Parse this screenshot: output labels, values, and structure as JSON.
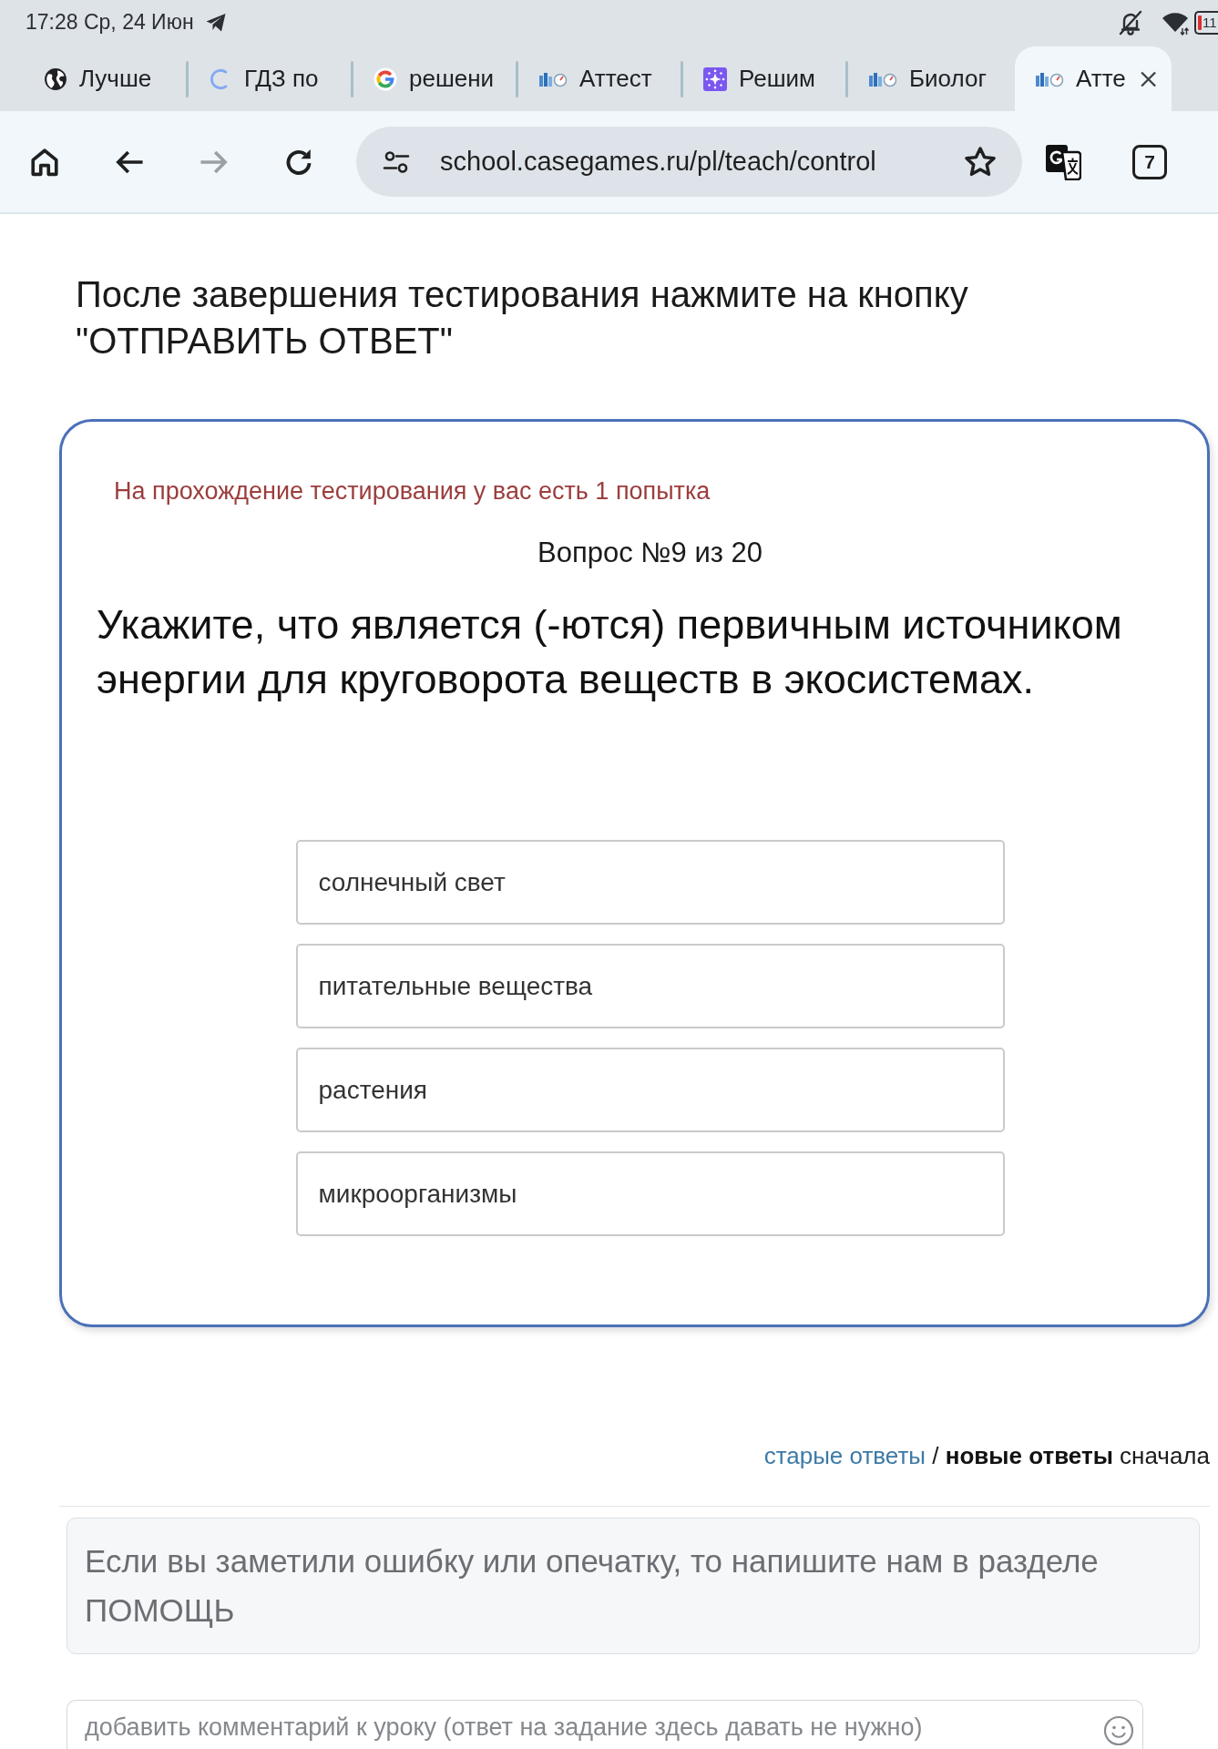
{
  "status_bar": {
    "time": "17:28 Ср, 24 Июн",
    "battery": "11"
  },
  "tabs": [
    {
      "title": "Лучше",
      "kind": "globe",
      "selected": false
    },
    {
      "title": "ГДЗ по",
      "kind": "loading",
      "selected": false
    },
    {
      "title": "решени",
      "kind": "google",
      "selected": false
    },
    {
      "title": "Аттест",
      "kind": "site",
      "selected": false
    },
    {
      "title": "Решим",
      "kind": "sparkle",
      "selected": false
    },
    {
      "title": "Биолог",
      "kind": "site",
      "selected": false
    },
    {
      "title": "Атте",
      "kind": "site",
      "selected": true
    }
  ],
  "toolbar": {
    "buttons": [
      {
        "kind": "home",
        "disabled": false
      },
      {
        "kind": "back",
        "disabled": false
      },
      {
        "kind": "forward",
        "disabled": true
      },
      {
        "kind": "reload",
        "disabled": false
      }
    ],
    "url": "school.casegames.ru/pl/teach/control",
    "tab_count": "7"
  },
  "page": {
    "heading": "После завершения тестирования нажмите на кнопку \"ОТПРАВИТЬ ОТВЕТ\"",
    "test_card": {
      "attempts_note": "На прохождение тестирования у вас есть 1 попытка",
      "question_number": "Вопрос №9 из 20",
      "question": "Укажите, что является (-ются) первичным источником энергии для круговорота веществ в экосистемах.",
      "options": [
        {
          "label": "солнечный свет",
          "selected": false
        },
        {
          "label": "питательные вещества",
          "selected": false
        },
        {
          "label": "растения",
          "selected": false
        },
        {
          "label": "микроорганизмы",
          "selected": false
        }
      ]
    },
    "sort": {
      "options": [
        {
          "label": "старые ответы",
          "selected": false
        },
        {
          "label": "новые ответы",
          "selected": true
        }
      ],
      "separator": "/",
      "suffix": "сначала"
    },
    "help_notice": "Если вы заметили ошибку или опечатку, то напишите нам в разделе ПОМОЩЬ",
    "comment_field": {
      "placeholder": "добавить комментарий к уроку (ответ на задание здесь давать не нужно)"
    }
  }
}
